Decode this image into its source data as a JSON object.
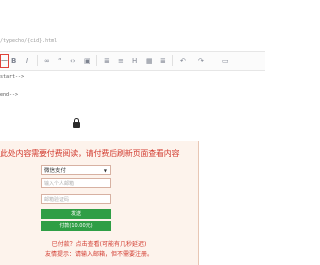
{
  "path": "/typecho/{cid}.html",
  "toolbar": {
    "buttons": [
      {
        "name": "hr-button",
        "glyph": "—",
        "selected": true
      },
      {
        "name": "bold-button",
        "glyph": "B"
      },
      {
        "name": "italic-button",
        "glyph": "I"
      },
      {
        "name": "link-button",
        "glyph": "∞"
      },
      {
        "name": "quote-button",
        "glyph": "“"
      },
      {
        "name": "code-button",
        "glyph": "‹›"
      },
      {
        "name": "image-button",
        "glyph": "▣"
      },
      {
        "name": "ordered-list-button",
        "glyph": "≣"
      },
      {
        "name": "unordered-list-button",
        "glyph": "≡"
      },
      {
        "name": "heading-button",
        "glyph": "H"
      },
      {
        "name": "table-button",
        "glyph": "▦"
      },
      {
        "name": "more-button",
        "glyph": "≣"
      },
      {
        "name": "undo-button",
        "glyph": "↶"
      },
      {
        "name": "redo-button",
        "glyph": "↷"
      },
      {
        "name": "preview-button",
        "glyph": "▭"
      }
    ]
  },
  "code": {
    "start": "start-->",
    "end": "end-->"
  },
  "paywall": {
    "title": "此处内容需要付费阅读，请付费后刷新页面查看内容",
    "payment_select": "微信支付",
    "email_placeholder": "输入个人邮箱",
    "code_placeholder": "邮箱验证码",
    "send_button": "发送",
    "pay_button": "付款(10.00元)",
    "note1": "已付款？点击查看(可能有几秒延迟)",
    "note2": "友情提示：请输入邮箱，但不需要注册。"
  },
  "colors": {
    "accent": "#d23b2f",
    "button": "#2f9e45",
    "panel_bg": "#fdf3ec"
  }
}
